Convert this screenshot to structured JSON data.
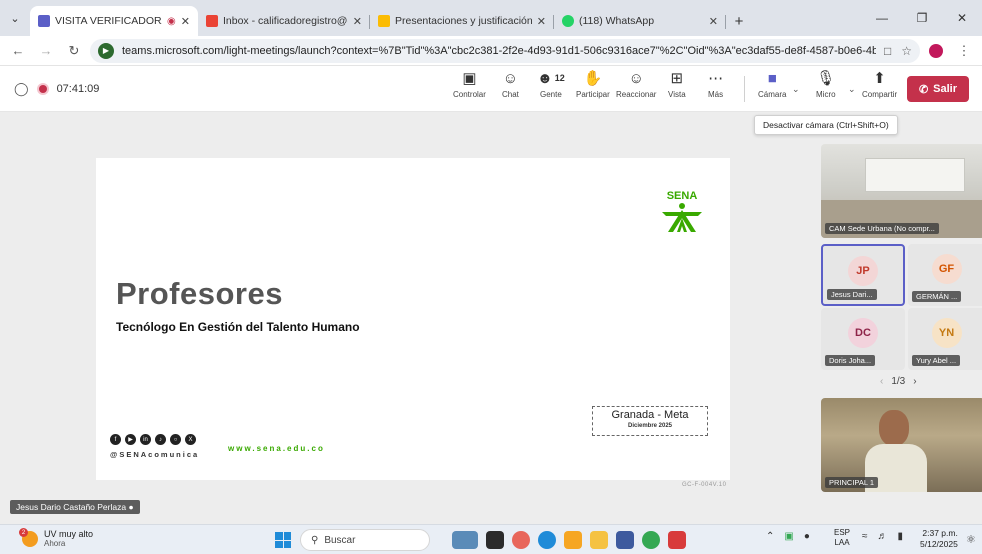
{
  "browser": {
    "tabs": [
      {
        "title": "VISITA VERIFICADORA PAR",
        "favicon_color": "#5b5fc7",
        "active": true
      },
      {
        "title": "Inbox - calificadoregistro@gma",
        "favicon_color": "#ea4335",
        "active": false
      },
      {
        "title": "Presentaciones y justificación C",
        "favicon_color": "#fbbc04",
        "active": false
      },
      {
        "title": "(118) WhatsApp",
        "favicon_color": "#25d366",
        "active": false
      }
    ],
    "new_tab": "+",
    "url": "teams.microsoft.com/light-meetings/launch?context=%7B\"Tid\"%3A\"cbc2c381-2f2e-4d93-91d1-506c9316ace7\"%2C\"Oid\"%3A\"ec3daf55-de8f-4587-b0e6-4b4575680ac8..."
  },
  "teams": {
    "timer": "07:41:09",
    "toolbar": {
      "controlar": "Controlar",
      "chat": "Chat",
      "gente": "Gente",
      "gente_count": "12",
      "participar": "Participar",
      "reaccionar": "Reaccionar",
      "vista": "Vista",
      "mas": "Más",
      "camara": "Cámara",
      "micro": "Micro",
      "compartir": "Compartir",
      "salir": "Salir"
    },
    "tooltip": "Desactivar cámara (Ctrl+Shift+O)",
    "presenter_name": "Jesus Dario Castaño Perlaza",
    "gallery": {
      "room": "CAM Sede Urbana (No compr...",
      "participants": [
        {
          "initials": "JP",
          "name": "Jesus Dari...",
          "bg": "#f3d6d6",
          "fg": "#c0392b",
          "active": true
        },
        {
          "initials": "GF",
          "name": "GERMÁN ...",
          "bg": "#f6dcd0",
          "fg": "#d35400",
          "active": false
        },
        {
          "initials": "DC",
          "name": "Doris Joha...",
          "bg": "#f2d2dc",
          "fg": "#8e2348",
          "active": false
        },
        {
          "initials": "YN",
          "name": "Yury Abel ...",
          "bg": "#f7e3c6",
          "fg": "#c47a12",
          "active": false
        }
      ],
      "page": "1/3",
      "self_label": "PRINCIPAL 1"
    }
  },
  "slide": {
    "logo_text": "SENA",
    "title": "Profesores",
    "subtitle": "Tecnólogo En Gestión del Talento Humano",
    "location": "Granada - Meta",
    "date": "Diciembre 2025",
    "handle": "@SENAcomunica",
    "website": "www.sena.edu.co",
    "doc_code": "GC-F-004V.10",
    "brand_color": "#39a900"
  },
  "taskbar": {
    "weather": "UV muy alto",
    "weather_sub": "Ahora",
    "weather_badge": "2",
    "search_placeholder": "Buscar",
    "lang": "ESP",
    "lang_sub": "LAA",
    "time": "2:37 p.m.",
    "date": "5/12/2025"
  }
}
